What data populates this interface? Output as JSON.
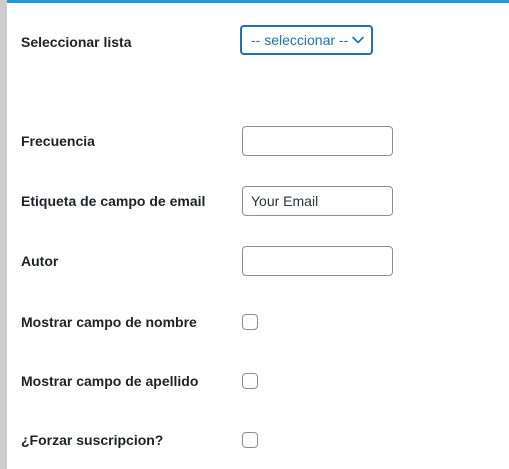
{
  "form": {
    "list_select": {
      "label": "Seleccionar lista",
      "selected": "-- seleccionar --",
      "icon": "chevron-down-icon"
    },
    "frequency": {
      "label": "Frecuencia",
      "value": ""
    },
    "email_label": {
      "label": "Etiqueta de campo de email",
      "value": "Your Email"
    },
    "author": {
      "label": "Autor",
      "value": ""
    },
    "show_first_name": {
      "label": "Mostrar campo de nombre",
      "checked": false
    },
    "show_last_name": {
      "label": "Mostrar campo de apellido",
      "checked": false
    },
    "force_subscription": {
      "label": "¿Forzar suscripcion?",
      "checked": false
    }
  },
  "colors": {
    "accent": "#2271b1",
    "top_border": "#1f9ad7",
    "left_border": "#cdcdcd",
    "label_text": "#1d2327",
    "input_border": "#8c8f94"
  }
}
